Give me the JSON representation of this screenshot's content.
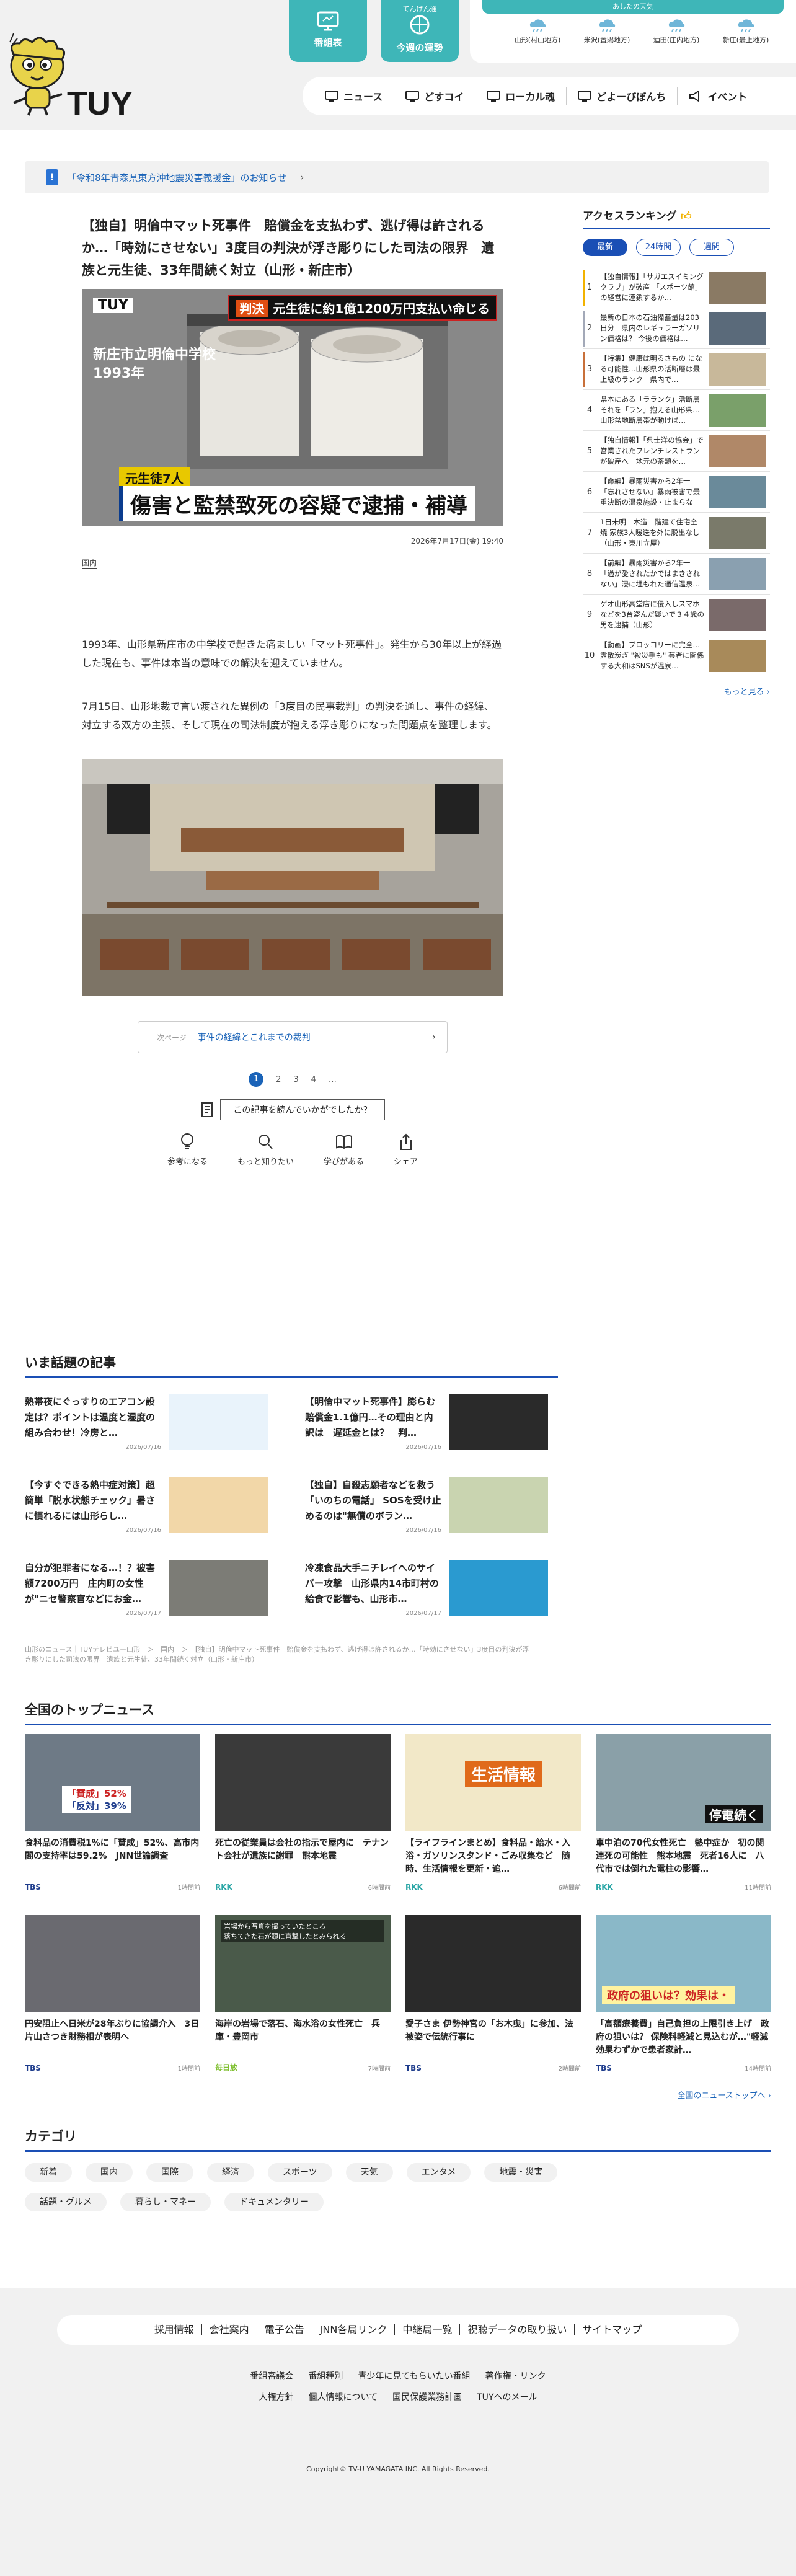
{
  "header": {
    "logo": "TUY",
    "tiles": [
      {
        "label": "番組表",
        "sub": ""
      },
      {
        "label": "今週の運勢",
        "sub": "てんげん通"
      }
    ],
    "weather": {
      "title": "あしたの天気",
      "places": [
        "山形(村山地方)",
        "米沢(置賜地方)",
        "酒田(庄内地方)",
        "新庄(最上地方)"
      ]
    },
    "nav": [
      "ニュース",
      "どすコイ",
      "ローカル魂",
      "どよーびぼんち",
      "イベント"
    ]
  },
  "notice": {
    "flag": "!",
    "text": "「令和8年青森県東方沖地震災害義援金」のお知らせ",
    "chev": "›"
  },
  "article": {
    "headline": "【独自】明倫中マット死事件　賠償金を支払わず、逃げ得は許されるか…「時効にさせない」3度目の判決が浮き彫りにした司法の限界　遺族と元生徒、33年間続く対立（山形・新庄市）",
    "hero": {
      "logo": "TUY",
      "top_tag": "判決",
      "top_caption": "元生徒に約1億1200万円支払い命じる",
      "school": [
        "新庄市立明倫中学校",
        "1993年"
      ],
      "sub_caption": "元生徒7人",
      "main_caption": "傷害と監禁致死の容疑で逮捕・補導"
    },
    "date": "2026年7月17日(金) 19:40",
    "tag": "国内",
    "para1": "1993年、山形県新庄市の中学校で起きた痛ましい「マット死事件」。発生から30年以上が経過した現在も、事件は本当の意味での解決を迎えていません。",
    "para2": "7月15日、山形地裁で言い渡された異例の「3度目の民事裁判」の判決を通し、事件の経緯、対立する双方の主張、そして現在の司法制度が抱える浮き彫りになった問題点を整理します。",
    "next": {
      "label": "次ページ",
      "text": "事件の経緯とこれまでの裁判",
      "chev": "›"
    },
    "pager": [
      "1",
      "2",
      "3",
      "4",
      "…"
    ],
    "feedback_q": "この記事を読んでいかがでしたか？",
    "feedback": [
      "参考になる",
      "もっと知りたい",
      "学びがある",
      "シェア"
    ]
  },
  "ranking": {
    "title": "アクセスランキング",
    "tabs": [
      "最新",
      "24時間",
      "週間"
    ],
    "items": [
      {
        "n": "1",
        "text": "【独自情報】「サガエスイミングクラブ」が破産 「スポーツ館」の経営に連鎖するか…",
        "color": "#f2b200"
      },
      {
        "n": "2",
        "text": "最新の日本の石油備蓄量は203日分　県内のレギュラーガソリン価格は？ 今後の価格は…",
        "color": "#a3a9b8"
      },
      {
        "n": "3",
        "text": "【特集】健康は明るさもの になる可能性…山形県の活断層は最上級のランク　県内で…",
        "color": "#c8703a"
      },
      {
        "n": "4",
        "text": "県本にある「ラランク」活断層それを「ラン」抱える山形県…山形盆地断層帯が動けば…",
        "color": ""
      },
      {
        "n": "5",
        "text": "【独自情報】「県士洋の協会」で営業されたフレンチレストランが破産へ　地元の茶類を…",
        "color": ""
      },
      {
        "n": "6",
        "text": "【命編】暴雨災害から2年一「忘れさせない」暴雨被害で最重決断の温泉施設・止まらない…",
        "color": ""
      },
      {
        "n": "7",
        "text": "1日未明　木造二階建て住宅全焼 家族3人暖送を外に脱出なし（山形・東川立屋）",
        "color": ""
      },
      {
        "n": "8",
        "text": "【前編】暴雨災害から2年一「過が愛されたかではまきされない」浸に埋もれた通信温泉…",
        "color": ""
      },
      {
        "n": "9",
        "text": "ゲオ山形高堂店に侵入しスマホなどを3台盗んだ疑いで３４歳の男を逮捕（山形）",
        "color": ""
      },
      {
        "n": "10",
        "text": "【動画】ブロッコリーに完全…露散炭ぎ \"被災手も\" 芸者に関係する大和はSNSが温泉…",
        "color": ""
      }
    ],
    "more": "もっと見る ›"
  },
  "trending": {
    "title": "いま話題の記事",
    "items": [
      {
        "title": "熱帯夜にぐっすりのエアコン設定は？ポイントは温度と湿度の組み合わせ！冷房と…",
        "date": "2026/07/16"
      },
      {
        "title": "【明倫中マット死事件】膨らむ賠償金1.1億円…その理由と内訳は　遅延金とは？　判…",
        "date": "2026/07/16"
      },
      {
        "title": "【今すぐできる熱中症対策】超簡単「脱水状態チェック」暑さに慣れるには山形らし…",
        "date": "2026/07/16"
      },
      {
        "title": "【独自】自殺志願者などを救う「いのちの電話」 SOSを受け止めるのは\"無償のボラン…",
        "date": "2026/07/16"
      },
      {
        "title": "自分が犯罪者になる…！？被害額7200万円　庄内町の女性が\"ニセ警察官などにお金…",
        "date": "2026/07/17"
      },
      {
        "title": "冷凍食品大手ニチレイへのサイバー攻撃　山形県内14市町村の給食で影響も、山形市…",
        "date": "2026/07/17"
      }
    ],
    "breadcrumb": "山形のニュース｜TUYテレビユー山形　＞　国内　＞　【独自】明倫中マット死事件　賠償金を支払わず、逃げ得は許されるか…「時効にさせない」3度目の判決が浮き彫りにした司法の限界　遺族と元生徒、33年間続く対立（山形・新庄市）"
  },
  "topnews": {
    "title": "全国のトップニュース",
    "items": [
      {
        "title": "食料品の消費税1%に「賛成」52%、高市内閣の支持率は59.2%　JNN世論調査",
        "src": "TBS",
        "date": "1時間前",
        "cls": "src-tbs"
      },
      {
        "title": "死亡の従業員は会社の指示で屋内に　テナント会社が遺族に謝罪　熊本地震",
        "src": "RKK",
        "date": "6時間前",
        "cls": "src-rkk"
      },
      {
        "title": "【ライフラインまとめ】食料品・給水・入浴・ガソリンスタンド・ごみ収集など　随時、生活情報を更新・追…",
        "src": "RKK",
        "date": "6時間前",
        "cls": "src-rkk"
      },
      {
        "title": "車中泊の70代女性死亡　熱中症か　初の関連死の可能性　熊本地震　死者16人に　八代市では倒れた電柱の影響…",
        "src": "RKK",
        "date": "11時間前",
        "cls": "src-rkk"
      },
      {
        "title": "円安阻止へ日米が28年ぶりに協調介入　3日 片山さつき財務相が表明へ",
        "src": "TBS",
        "date": "1時間前",
        "cls": "src-tbs"
      },
      {
        "title": "海岸の岩場で落石、海水浴の女性死亡　兵庫・豊岡市",
        "src": "毎日放",
        "date": "7時間前",
        "cls": "src-tuy"
      },
      {
        "title": "愛子さま 伊勢神宮の「お木曳」に参加、法被姿で伝統行事に",
        "src": "TBS",
        "date": "2時間前",
        "cls": "src-tbs"
      },
      {
        "title": "「高額療養費」自己負担の上限引き上げ　政府の狙いは？ 保険料軽減と見込むが…\"軽減効果わずかで患者家計…",
        "src": "TBS",
        "date": "14時間前",
        "cls": "src-tbs"
      }
    ],
    "captions": {
      "poll_a": "「賛成」52%",
      "poll_b": "「反対」39%",
      "life": "生活情報",
      "outage": "停電続く",
      "rockfall": "岩場から写真を撮っていたところ\n落ちてきた石が頭に直撃したとみられる",
      "policy": "政府の狙いは？効果は・"
    },
    "more": "全国のニューストップへ ›"
  },
  "category": {
    "title": "カテゴリ",
    "items": [
      "新着",
      "国内",
      "国際",
      "経済",
      "スポーツ",
      "天気",
      "エンタメ",
      "地震・災害",
      "話題・グルメ",
      "暮らし・マネー",
      "ドキュメンタリー"
    ]
  },
  "footer": {
    "links": [
      "採用情報",
      "会社案内",
      "電子公告",
      "JNN各局リンク",
      "中継局一覧",
      "視聴データの取り扱い",
      "サイトマップ"
    ],
    "sub1": [
      "番組審議会",
      "番組種別",
      "青少年に見てもらいたい番組",
      "著作権・リンク"
    ],
    "sub2": [
      "人権方針",
      "個人情報について",
      "国民保護業務計画",
      "TUYへのメール"
    ],
    "copyright": "Copyright© TV-U YAMAGATA INC. All Rights Reserved."
  }
}
